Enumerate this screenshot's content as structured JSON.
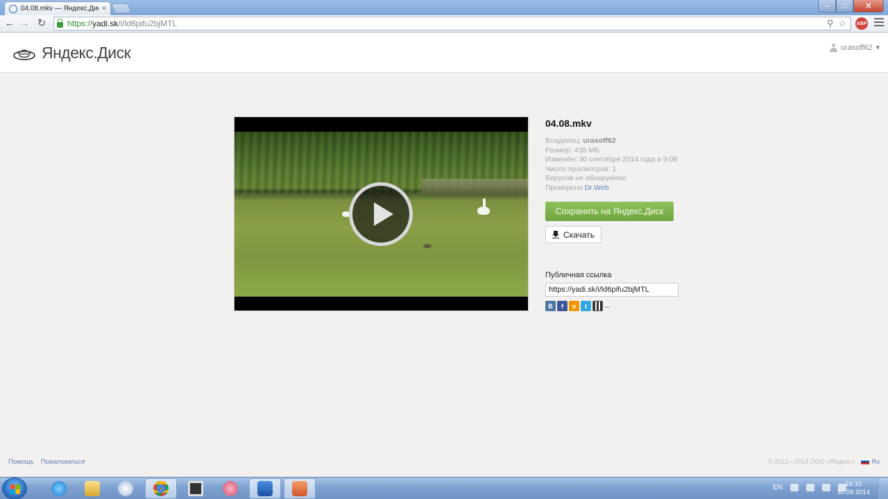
{
  "browser": {
    "tab_title": "04.08.mkv — Яндекс.Диск",
    "tab_close": "×",
    "window_min": "–",
    "window_max": "□",
    "window_close": "✕",
    "back": "←",
    "forward": "→",
    "reload": "↻",
    "url_scheme": "https://",
    "url_host": "yadi.sk",
    "url_path": "/i/ld6pifu2bjMTL",
    "key_icon": "⚲",
    "star_icon": "☆",
    "abp_label": "ABP"
  },
  "header": {
    "logo_text": "Яндекс.Диск",
    "username": "urasoff62",
    "username_caret": "▾"
  },
  "file": {
    "name": "04.08.mkv",
    "owner_label": "Владелец:",
    "owner": "urasoff62",
    "size": "Размер: 438 МБ",
    "modified": "Изменён: 30 сентября 2014 года в 9:08",
    "views": "Число просмотров: 1",
    "virus": "Вирусов не обнаружено",
    "checked_label": "Проверено",
    "checked_by": "Dr.Web"
  },
  "actions": {
    "save_label": "Сохранить на Яндекс.Диск",
    "download_label": "Скачать"
  },
  "share": {
    "public_link_label": "Публичная ссылка",
    "public_link_value": "https://yadi.sk/i/ld6pifu2bjMTL",
    "vk": "В",
    "fb": "f",
    "ok": "о",
    "tw": "t",
    "more": "..."
  },
  "footer": {
    "help": "Помощь",
    "complain": "Пожаловаться",
    "copyright": "© 2012—2014 ООО «Яндекс»",
    "lang": "Ru"
  },
  "taskbar": {
    "lang": "EN",
    "time": "16:10",
    "date": "30.09.2014"
  },
  "colors": {
    "save_button": "#7ab14a",
    "link": "#5a7fb8",
    "page_bg": "#f3f1ef"
  }
}
